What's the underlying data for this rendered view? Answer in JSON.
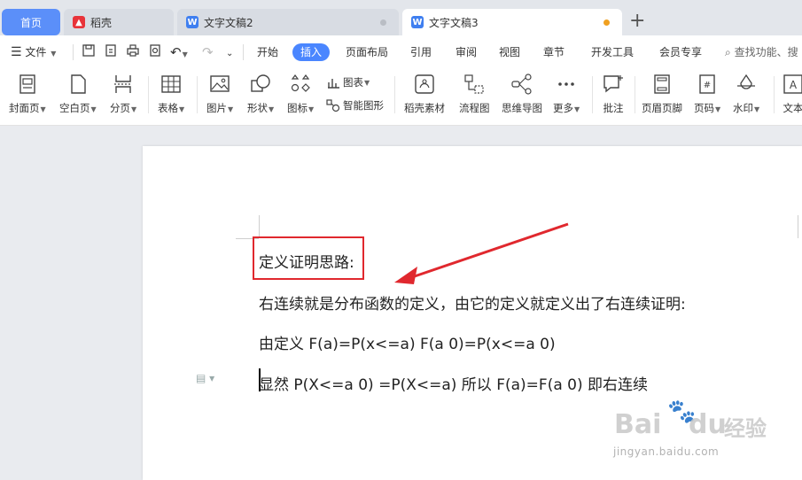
{
  "tabs": [
    {
      "label": "首页"
    },
    {
      "label": "稻壳"
    },
    {
      "label": "文字文稿2"
    },
    {
      "label": "文字文稿3"
    }
  ],
  "tab_add": "+",
  "menu": {
    "file": "文件",
    "items": [
      "开始",
      "插入",
      "页面布局",
      "引用",
      "审阅",
      "视图",
      "章节",
      "开发工具",
      "会员专享"
    ],
    "search": "查找功能、搜"
  },
  "ribbon": {
    "cover": "封面页",
    "blank": "空白页",
    "break": "分页",
    "table": "表格",
    "picture": "图片",
    "shape": "形状",
    "icon": "图标",
    "chart": "图表",
    "smart": "智能图形",
    "daoke_material": "稻壳素材",
    "flowchart": "流程图",
    "mindmap": "思维导图",
    "more": "更多",
    "comment": "批注",
    "header_footer": "页眉页脚",
    "page_number": "页码",
    "watermark": "水印",
    "textbox": "文本"
  },
  "document": {
    "line1": "定义证明思路:",
    "line2": "右连续就是分布函数的定义，由它的定义就定义出了右连续证明:",
    "line3": "由定义 F(a)=P(x<=a)  F(a  0)=P(x<=a  0)",
    "line4": "显然 P(X<=a  0)  =P(X<=a)  所以 F(a)=F(a  0)  即右连续"
  },
  "watermark": {
    "brand": "Bai",
    "brand2": "du",
    "jy": "经验",
    "url": "jingyan.baidu.com"
  },
  "colors": {
    "accent": "#4a86ff",
    "annotation_red": "#e0282e",
    "tab_active": "#ffffff",
    "home_tab": "#5b8ff9"
  }
}
